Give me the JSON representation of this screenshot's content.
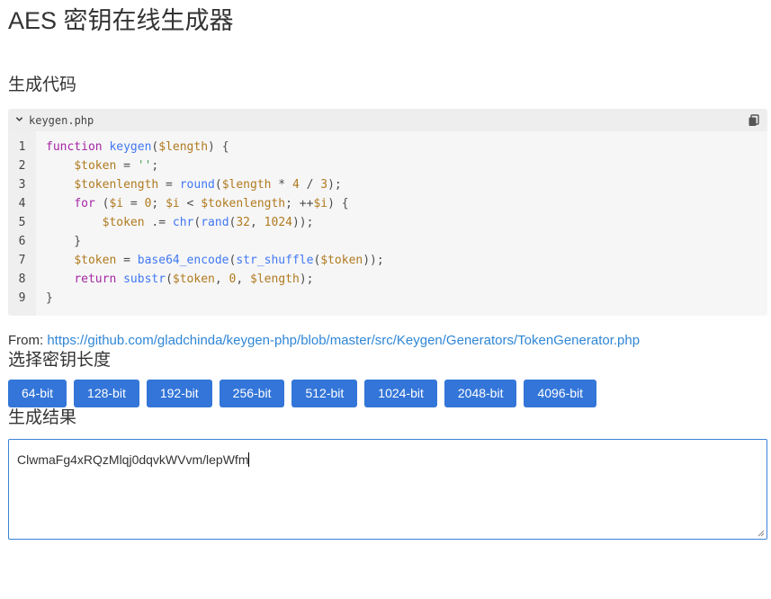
{
  "page": {
    "title": "AES 密钥在线生成器"
  },
  "code_section": {
    "title": "生成代码",
    "file_name": "keygen.php",
    "line_numbers": [
      "1",
      "2",
      "3",
      "4",
      "5",
      "6",
      "7",
      "8",
      "9"
    ],
    "icons": {
      "collapse": "chevron-down-icon",
      "copy": "copy-icon"
    }
  },
  "source": {
    "prefix": "From: ",
    "url": "https://github.com/gladchinda/keygen-php/blob/master/src/Keygen/Generators/TokenGenerator.php"
  },
  "key_length_section": {
    "title": "选择密钥长度",
    "buttons": [
      "64-bit",
      "128-bit",
      "192-bit",
      "256-bit",
      "512-bit",
      "1024-bit",
      "2048-bit",
      "4096-bit"
    ]
  },
  "result_section": {
    "title": "生成结果",
    "value": "ClwmaFg4xRQzMlqj0dqvkWVvm/lepWfm"
  },
  "colors": {
    "button_bg": "#3375d8",
    "link": "#2f86d6",
    "keyword": "#a626a4",
    "function": "#4078f2",
    "variable": "#b07a1e",
    "string": "#50a14f"
  }
}
